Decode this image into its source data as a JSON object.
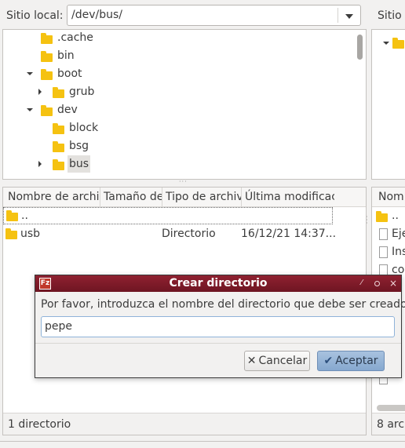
{
  "local": {
    "label": "Sitio local:",
    "path": "/dev/bus/"
  },
  "remote": {
    "label": "Sitio"
  },
  "tree": [
    {
      "label": ".cache",
      "level": 1,
      "expander": "none"
    },
    {
      "label": "bin",
      "level": 1,
      "expander": "none"
    },
    {
      "label": "boot",
      "level": 1,
      "expander": "open"
    },
    {
      "label": "grub",
      "level": 2,
      "expander": "closed"
    },
    {
      "label": "dev",
      "level": 1,
      "expander": "open"
    },
    {
      "label": "block",
      "level": 2,
      "expander": "none"
    },
    {
      "label": "bsg",
      "level": 2,
      "expander": "none"
    },
    {
      "label": "bus",
      "level": 2,
      "expander": "closed"
    }
  ],
  "filelist": {
    "columns": [
      "Nombre de archi…",
      "Tamaño de",
      "Tipo de archiv",
      "Última modificac"
    ],
    "rows": [
      {
        "name": "..",
        "size": "",
        "type": "",
        "modified": ""
      },
      {
        "name": "usb",
        "size": "",
        "type": "Directorio",
        "modified": "16/12/21 14:37..."
      }
    ],
    "status": "1 directorio"
  },
  "remote_list": {
    "header": "Nom",
    "items": [
      "..",
      "Eje",
      "Ins",
      "co",
      "",
      "",
      "",
      "",
      "",
      ""
    ],
    "status": "8 arc"
  },
  "dialog": {
    "title": "Crear directorio",
    "prompt": "Por favor, introduzca el nombre del directorio que debe ser creado:",
    "value": "pepe",
    "cancel": "Cancelar",
    "ok": "Aceptar",
    "icon": "filezilla-icon"
  }
}
